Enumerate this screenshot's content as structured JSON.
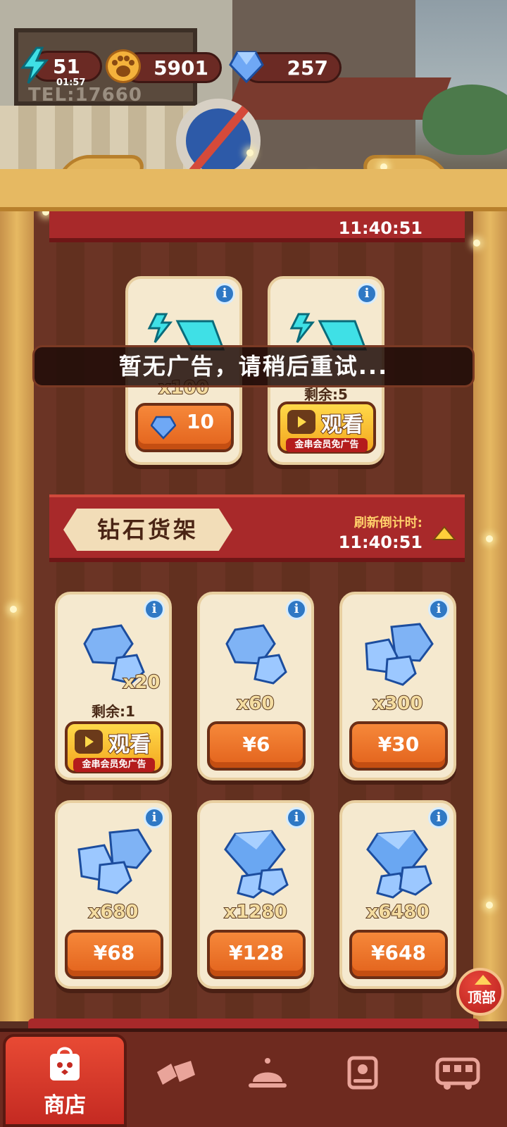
{
  "resources": {
    "energy": {
      "value": "51",
      "timer": "01:57"
    },
    "paw": {
      "value": "5901"
    },
    "gem": {
      "value": "257"
    }
  },
  "scene": {
    "sign_text": "TEL:17660"
  },
  "energy_shelf": {
    "refresh_time": "11:40:51",
    "items": [
      {
        "qty": "x100",
        "price": "10"
      },
      {
        "remain": "剩余:5",
        "watch_label": "观看",
        "vip_note": "金串会员免广告"
      }
    ]
  },
  "toast": {
    "message": "暂无广告，请稍后重试..."
  },
  "diamond_shelf": {
    "title": "钻石货架",
    "refresh_label": "刷新倒计时:",
    "refresh_time": "11:40:51",
    "items": [
      {
        "qty": "x20",
        "remain": "剩余:1",
        "watch_label": "观看",
        "vip_note": "金串会员免广告"
      },
      {
        "qty": "x60",
        "price": "¥6"
      },
      {
        "qty": "x300",
        "price": "¥30"
      },
      {
        "qty": "x680",
        "price": "¥68"
      },
      {
        "qty": "x1280",
        "price": "¥128"
      },
      {
        "qty": "x6480",
        "price": "¥648"
      }
    ]
  },
  "top_button": {
    "label": "顶部"
  },
  "nav": {
    "items": [
      {
        "label": "商店",
        "icon": "shop-bag-icon",
        "active": true
      },
      {
        "label": "",
        "icon": "cards-icon"
      },
      {
        "label": "",
        "icon": "service-bell-icon"
      },
      {
        "label": "",
        "icon": "map-location-icon"
      },
      {
        "label": "",
        "icon": "bus-icon"
      }
    ]
  },
  "colors": {
    "banner_red": "#a8292a",
    "price_orange": "#e2621c",
    "watch_yellow": "#ffd94a",
    "info_blue": "#2f78c4",
    "card_cream": "#f5e9cf",
    "wood_dark": "#6b3425"
  }
}
